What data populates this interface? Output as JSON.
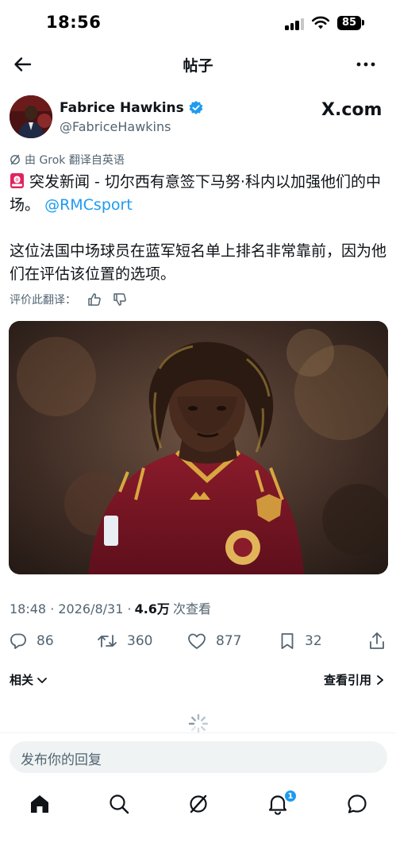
{
  "status_bar": {
    "time": "18:56",
    "battery": "85"
  },
  "header": {
    "title": "帖子"
  },
  "author": {
    "name": "Fabrice Hawkins",
    "handle": "@FabriceHawkins",
    "verified": true
  },
  "source_badge": "X.com",
  "translation_notice": "由 Grok 翻译自英语",
  "post": {
    "line1": "突发新闻 - 切尔西有意签下马努·科内以加强他们的中场。",
    "mention": "@RMCsport",
    "line2": "这位法国中场球员在蓝军短名单上排名非常靠前，因为他们在评估该位置的选项。"
  },
  "rate_translation_label": "评价此翻译：",
  "meta": {
    "time_date": "18:48 · 2026/8/31 ·",
    "views_count": "4.6万",
    "views_label": "次查看"
  },
  "actions": {
    "replies": "86",
    "reposts": "360",
    "likes": "877",
    "bookmarks": "32"
  },
  "related_label": "相关",
  "view_quotes_label": "查看引用",
  "reply_placeholder": "发布你的回复",
  "notifications_badge": "1",
  "colors": {
    "accent": "#1d9bf0",
    "text": "#0f1419",
    "secondary": "#536471"
  },
  "icons": [
    "back-arrow-icon",
    "more-icon",
    "verified-icon",
    "grok-icon",
    "thumb-up-icon",
    "thumb-down-icon",
    "reply-icon",
    "repost-icon",
    "like-icon",
    "bookmark-icon",
    "share-icon",
    "chevron-down-icon",
    "chevron-right-icon",
    "spinner-icon",
    "home-icon",
    "search-icon",
    "grok-tab-icon",
    "notifications-icon",
    "messages-icon"
  ]
}
